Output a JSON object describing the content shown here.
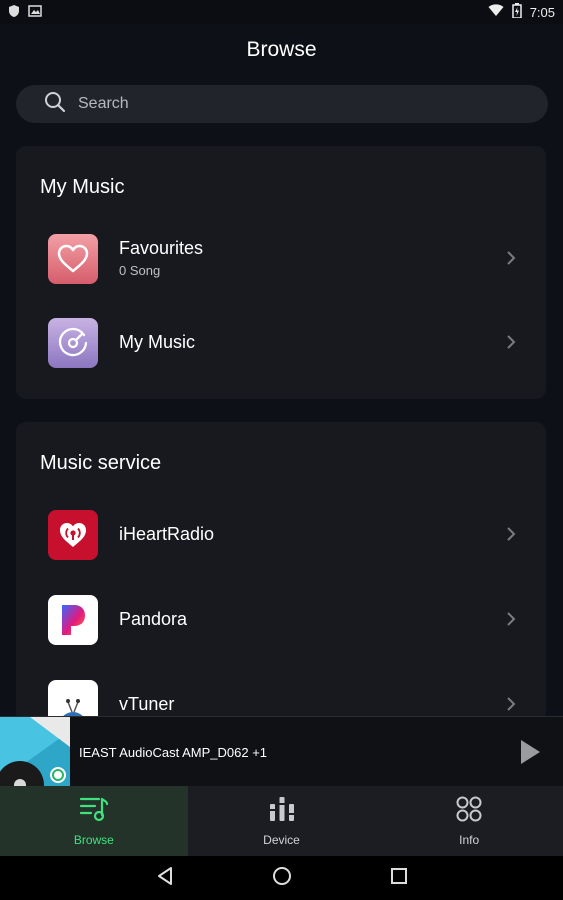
{
  "status_bar": {
    "time": "7:05"
  },
  "header": {
    "title": "Browse"
  },
  "search": {
    "placeholder": "Search"
  },
  "my_music": {
    "title": "My Music",
    "items": [
      {
        "title": "Favourites",
        "subtitle": "0 Song",
        "icon": "heart-icon"
      },
      {
        "title": "My Music",
        "icon": "music-disc-icon"
      }
    ]
  },
  "music_service": {
    "title": "Music service",
    "items": [
      {
        "title": "iHeartRadio",
        "icon": "iheartradio-logo-icon"
      },
      {
        "title": "Pandora",
        "icon": "pandora-logo-icon"
      },
      {
        "title": "vTuner",
        "icon": "vtuner-logo-icon"
      }
    ]
  },
  "player": {
    "device_text": "IEAST AudioCast AMP_D062  +1"
  },
  "tabs": [
    {
      "label": "Browse",
      "icon": "browse-music-icon",
      "active": true
    },
    {
      "label": "Device",
      "icon": "device-equalizer-icon",
      "active": false
    },
    {
      "label": "Info",
      "icon": "info-grid-icon",
      "active": false
    }
  ],
  "colors": {
    "background": "#0e1017",
    "card": "#17191f",
    "accent_green": "#3fe27c",
    "favourites_gradient": [
      "#f29aa0",
      "#d9606e"
    ],
    "mymusic_gradient": [
      "#c7b0e2",
      "#8e78c2"
    ],
    "iheart_red": "#c6102e"
  }
}
